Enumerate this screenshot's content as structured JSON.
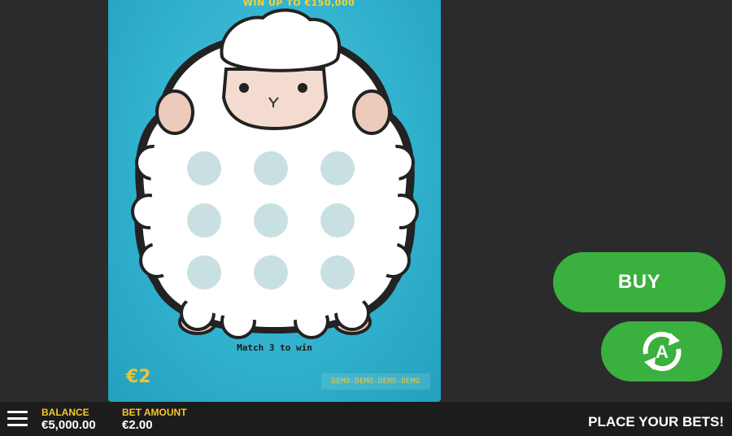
{
  "ticket": {
    "headline": "WIN UP TO €150,000",
    "instruction": "Match 3 to win",
    "price": "€2",
    "watermark": "DEMO-DEMO-DEMO-DEMO",
    "cells": 9
  },
  "controls": {
    "buy_label": "BUY",
    "autoplay_icon": "autoplay-icon"
  },
  "bottom_bar": {
    "menu_icon": "hamburger-menu-icon",
    "balance_label": "BALANCE",
    "balance_value": "€5,000.00",
    "bet_label": "BET AMOUNT",
    "bet_value": "€2.00",
    "status": "PLACE YOUR BETS!"
  },
  "colors": {
    "page_bg": "#2b2b2b",
    "ticket_bg": "#2fb0cc",
    "button_green": "#3ab03e",
    "accent_yellow": "#f2c82c"
  }
}
